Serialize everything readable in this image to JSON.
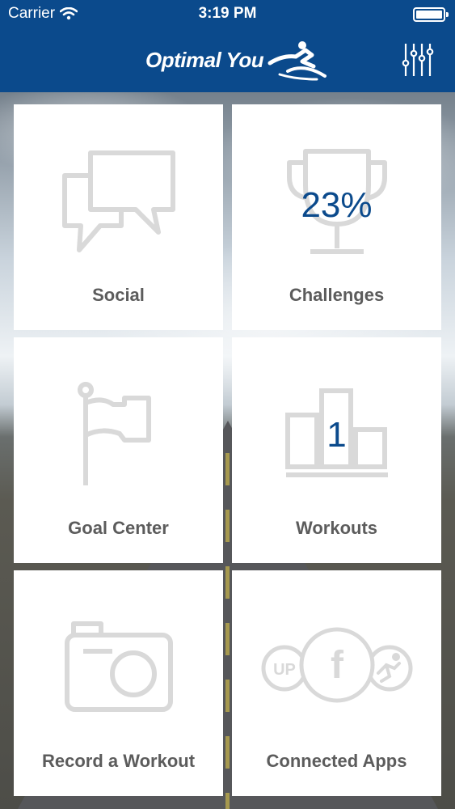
{
  "status_bar": {
    "carrier": "Carrier",
    "time": "3:19 PM"
  },
  "header": {
    "logo_text": "Optimal You",
    "settings_icon": "sliders-icon"
  },
  "tiles": [
    {
      "label": "Social",
      "icon": "chat-bubbles-icon",
      "value": ""
    },
    {
      "label": "Challenges",
      "icon": "trophy-icon",
      "value": "23%"
    },
    {
      "label": "Goal Center",
      "icon": "flag-icon",
      "value": ""
    },
    {
      "label": "Workouts",
      "icon": "podium-icon",
      "value": "1"
    },
    {
      "label": "Record a Workout",
      "icon": "camera-icon",
      "value": ""
    },
    {
      "label": "Connected Apps",
      "icon": "connected-apps-icon",
      "value": "",
      "icon_text": [
        "UP",
        "f"
      ]
    }
  ],
  "colors": {
    "header_bg": "#0b4a8c",
    "tile_bg": "#ffffff",
    "icon_gray": "#d9d9d9",
    "label_gray": "#5c5c5c",
    "value_blue": "#0b4a8c"
  }
}
